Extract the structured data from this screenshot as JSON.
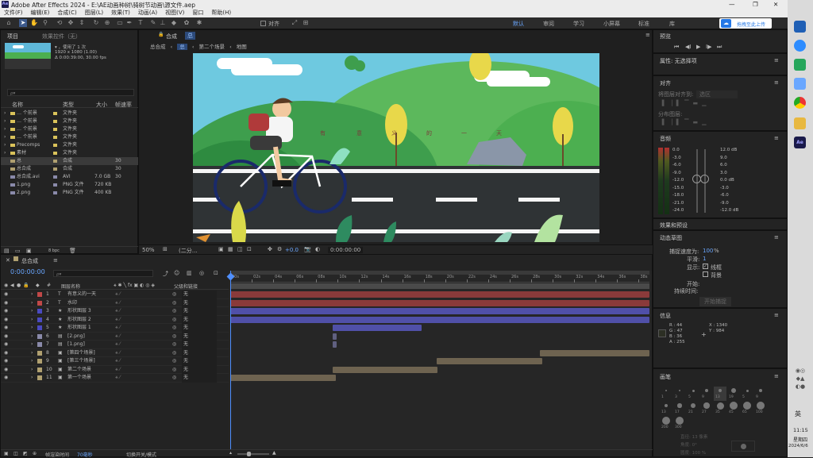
{
  "app": {
    "icon": "Ae",
    "title": "Adobe After Effects 2024 - E:\\AE动画种树\\骑树节动画\\源文件.aep",
    "window_controls": [
      "—",
      "❐",
      "✕"
    ]
  },
  "menu": [
    "文件(F)",
    "编辑(E)",
    "合成(C)",
    "图层(L)",
    "效果(T)",
    "动画(A)",
    "视图(V)",
    "窗口",
    "帮助(H)"
  ],
  "toolbar": {
    "snap_label": "对齐",
    "workspaces": [
      "默认",
      "审阅",
      "学习",
      "小屏幕",
      "标准",
      "库"
    ],
    "upload_label": "拖拽至此上传"
  },
  "project": {
    "tab": "项目",
    "effects_tab": "效果控件（无）",
    "comp_name": "▾ ，使用了 1 次",
    "resolution": "1920 x 1080 (1.00)",
    "duration": "Δ 0:00:39:00, 30.00 fps",
    "search_placeholder": "ρ▾",
    "columns": [
      "名称",
      "类型",
      "大小",
      "帧速率"
    ],
    "items": [
      {
        "name": "… 个前景",
        "type": "文件夹",
        "size": "",
        "rate": "",
        "color": "#d9c25a"
      },
      {
        "name": "… 个前景",
        "type": "文件夹",
        "size": "",
        "rate": "",
        "color": "#d9c25a"
      },
      {
        "name": "… 个前景",
        "type": "文件夹",
        "size": "",
        "rate": "",
        "color": "#d9c25a"
      },
      {
        "name": "… 个前景",
        "type": "文件夹",
        "size": "",
        "rate": "",
        "color": "#d9c25a"
      },
      {
        "name": "Precomps",
        "type": "文件夹",
        "size": "",
        "rate": "",
        "color": "#d9c25a"
      },
      {
        "name": "素材",
        "type": "文件夹",
        "size": "",
        "rate": "",
        "color": "#d9c25a"
      },
      {
        "name": "总",
        "type": "合成",
        "size": "",
        "rate": "30",
        "color": "#b0a070"
      },
      {
        "name": "总合成",
        "type": "合成",
        "size": "",
        "rate": "30",
        "color": "#b0a070"
      },
      {
        "name": "总合成.avi",
        "type": "AVI",
        "size": "7.0 GB",
        "rate": "30",
        "color": "#8a8aaa"
      },
      {
        "name": "1.png",
        "type": "PNG 文件",
        "size": "720 KB",
        "rate": "",
        "color": "#8a8aaa"
      },
      {
        "name": "2.png",
        "type": "PNG 文件",
        "size": "400 KB",
        "rate": "",
        "color": "#8a8aaa"
      }
    ],
    "bpc": "8 bpc"
  },
  "comp": {
    "tab_label": "合成",
    "tab_name": "总",
    "breadcrumbs": [
      "总合成",
      "总",
      "第二个场景",
      "地图"
    ],
    "zoom": "50%",
    "resolution": "(二分…",
    "exposure": "+0.0",
    "timecode": "0:00:00:00",
    "subtitle_chars": [
      "有",
      "意",
      "义",
      "的",
      "一",
      "天"
    ]
  },
  "timeline": {
    "tab": "总合成",
    "timecode": "0:00:00:00",
    "search_placeholder": "ρ▾",
    "col_name": "图层名称",
    "col_parent": "父级和链接",
    "ruler": [
      "00s",
      "02s",
      "04s",
      "06s",
      "08s",
      "10s",
      "12s",
      "14s",
      "16s",
      "18s",
      "20s",
      "22s",
      "24s",
      "26s",
      "28s",
      "30s",
      "32s",
      "34s",
      "36s",
      "38s"
    ],
    "layers": [
      {
        "num": "1",
        "icon": "T",
        "name": "有意义的一天",
        "label": "#c04848",
        "parent": "无",
        "bar_color": "#8a3a3a",
        "start": 0.0,
        "end": 39.0
      },
      {
        "num": "2",
        "icon": "T",
        "name": "水印",
        "label": "#c04848",
        "parent": "无",
        "bar_color": "#8a3a3a",
        "start": 0.0,
        "end": 39.0
      },
      {
        "num": "3",
        "icon": "★",
        "name": "形状图层 3",
        "label": "#4a4abf",
        "parent": "无",
        "bar_color": "#5050a8",
        "start": 0.0,
        "end": 39.0
      },
      {
        "num": "4",
        "icon": "★",
        "name": "形状图层 2",
        "label": "#4a4abf",
        "parent": "无",
        "bar_color": "#5050a8",
        "start": 0.0,
        "end": 39.0
      },
      {
        "num": "5",
        "icon": "★",
        "name": "形状图层 1",
        "label": "#4a4abf",
        "parent": "无",
        "bar_color": "#5050a8",
        "start": 9.5,
        "end": 17.8
      },
      {
        "num": "6",
        "icon": "▤",
        "name": "[2.png]",
        "label": "#8a8aaa",
        "parent": "无",
        "bar_color": "#606080",
        "start": 9.5,
        "end": 9.9
      },
      {
        "num": "7",
        "icon": "▤",
        "name": "[1.png]",
        "label": "#8a8aaa",
        "parent": "无",
        "bar_color": "#606080",
        "start": 9.5,
        "end": 9.9
      },
      {
        "num": "8",
        "icon": "▣",
        "name": "[第四个场景]",
        "label": "#b0a070",
        "parent": "无",
        "bar_color": "#6e6350",
        "start": 28.8,
        "end": 39.0
      },
      {
        "num": "9",
        "icon": "▣",
        "name": "[第三个场景]",
        "label": "#b0a070",
        "parent": "无",
        "bar_color": "#6e6350",
        "start": 19.2,
        "end": 29.0
      },
      {
        "num": "10",
        "icon": "▣",
        "name": "第二个场景",
        "label": "#b0a070",
        "parent": "无",
        "bar_color": "#6e6350",
        "start": 9.5,
        "end": 19.3
      },
      {
        "num": "11",
        "icon": "▣",
        "name": "第一个场景",
        "label": "#b0a070",
        "parent": "无",
        "bar_color": "#6e6350",
        "start": 0.0,
        "end": 9.8
      }
    ],
    "duration": 39,
    "footer": {
      "render_label": "帧渲染时间",
      "render_value": "70毫秒",
      "switch_label": "切换开关/模式"
    }
  },
  "preview": {
    "title": "预览",
    "buttons": [
      "⏮",
      "◀I",
      "▶",
      "I▶",
      "⏭"
    ]
  },
  "properties": {
    "title": "属性: 无选择项"
  },
  "align": {
    "title": "对齐",
    "align_to": "将图层对齐到:",
    "align_target": "选区",
    "distribute": "分布图层:"
  },
  "audio": {
    "title": "音频",
    "left_levels": [
      "0.0",
      "-3.0",
      "-6.0",
      "-9.0",
      "-12.0",
      "-15.0",
      "-18.0",
      "-21.0",
      "-24.0"
    ],
    "right_levels": [
      "12.0 dB",
      "9.0",
      "6.0",
      "3.0",
      "0.0 dB",
      "-3.0",
      "-6.0",
      "-9.0",
      "-12.0 dB"
    ]
  },
  "effects_presets": {
    "title": "效果和预设"
  },
  "motion_sketch": {
    "title": "动态草图",
    "capture_label": "捕捉速度为:",
    "capture_value": "100",
    "capture_unit": "%",
    "smooth_label": "平滑:",
    "smooth_value": "1",
    "show_label": "显示:",
    "wireframe": "线框",
    "background": "背景",
    "start_label": "开始:",
    "duration_label": "持续时间:",
    "start_button": "开始捕捉"
  },
  "info": {
    "title": "信息",
    "r": "R : 44",
    "g": "G : 47",
    "b": "B : 36",
    "a": "A : 255",
    "x": "X : 1340",
    "y": "Y : 984",
    "plus": "+"
  },
  "brushes": {
    "title": "画笔",
    "sizes": [
      "1",
      "3",
      "5",
      "9",
      "13",
      "19",
      "5",
      "9",
      "13",
      "17",
      "21",
      "27",
      "35",
      "45",
      "65",
      "100",
      "200",
      "300"
    ],
    "diameter": "直径: 13 像素",
    "angle": "角度: 0°",
    "roundness": "圆度: 100 %"
  },
  "system": {
    "lang": "英",
    "time": "11:15",
    "weekday": "星期四",
    "date": "2024/6/6"
  }
}
